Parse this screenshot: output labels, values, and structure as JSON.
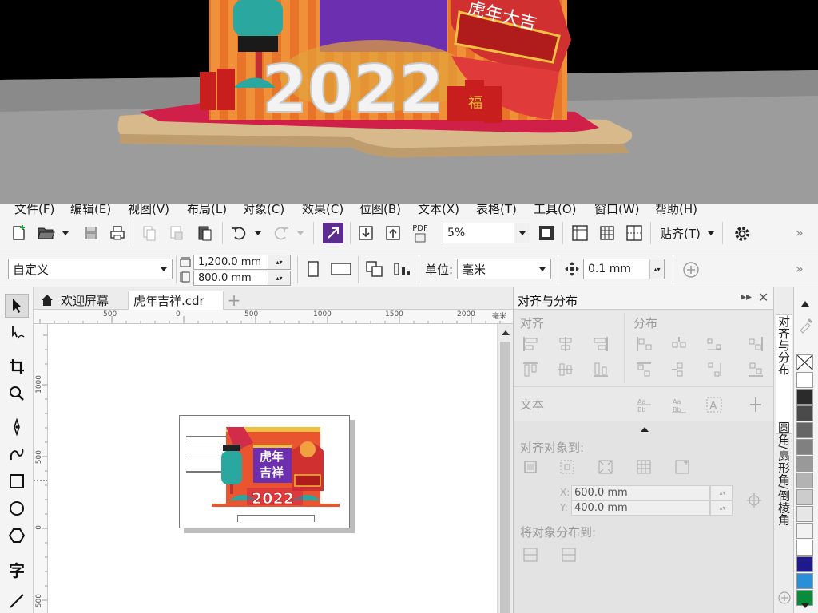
{
  "menu": [
    {
      "label": "文件(F)"
    },
    {
      "label": "编辑(E)"
    },
    {
      "label": "视图(V)"
    },
    {
      "label": "布局(L)"
    },
    {
      "label": "对象(C)"
    },
    {
      "label": "效果(C)"
    },
    {
      "label": "位图(B)"
    },
    {
      "label": "文本(X)"
    },
    {
      "label": "表格(T)"
    },
    {
      "label": "工具(O)"
    },
    {
      "label": "窗口(W)"
    },
    {
      "label": "帮助(H)"
    }
  ],
  "toolbar": {
    "pdf_label": "PDF",
    "zoom_value": "5%",
    "snap_label": "贴齐(T)"
  },
  "propbar": {
    "preset": "自定义",
    "width": "1,200.0 mm",
    "height": "800.0 mm",
    "unit_label": "单位:",
    "unit_value": "毫米",
    "nudge": "0.1 mm"
  },
  "tabs": {
    "welcome": "欢迎屏幕",
    "document": "虎年吉祥.cdr"
  },
  "ruler": {
    "top_ticks": [
      "500",
      "0",
      "500",
      "1000",
      "1500",
      "2000"
    ],
    "unit": "毫米",
    "left_ticks": [
      "1000",
      "500",
      "0",
      "500"
    ]
  },
  "artwork": {
    "title_line1": "虎年",
    "title_line2": "吉祥",
    "year": "2022"
  },
  "preview": {
    "year": "2022",
    "banner": "虎年大吉",
    "fu": "福"
  },
  "docker": {
    "title": "对齐与分布",
    "align_label": "对齐",
    "distribute_label": "分布",
    "text_label": "文本",
    "align_to_label": "对齐对象到:",
    "x_label": "X:",
    "x_value": "600.0 mm",
    "y_label": "Y:",
    "y_value": "400.0 mm",
    "distribute_to_label": "将对象分布到:"
  },
  "side_tabs": {
    "align_tab": "对齐与分布",
    "fillet_tab": "圆角/扇形角/倒棱角"
  },
  "palette": [
    "#ffffff",
    "#2b2b2b",
    "#4a4a4a",
    "#666666",
    "#808080",
    "#999999",
    "#b3b3b3",
    "#cccccc",
    "#e6e6e6",
    "#f2f2f2",
    "#ffffff",
    "#1e1a8c",
    "#2a8fd6",
    "#0a8a3a"
  ]
}
